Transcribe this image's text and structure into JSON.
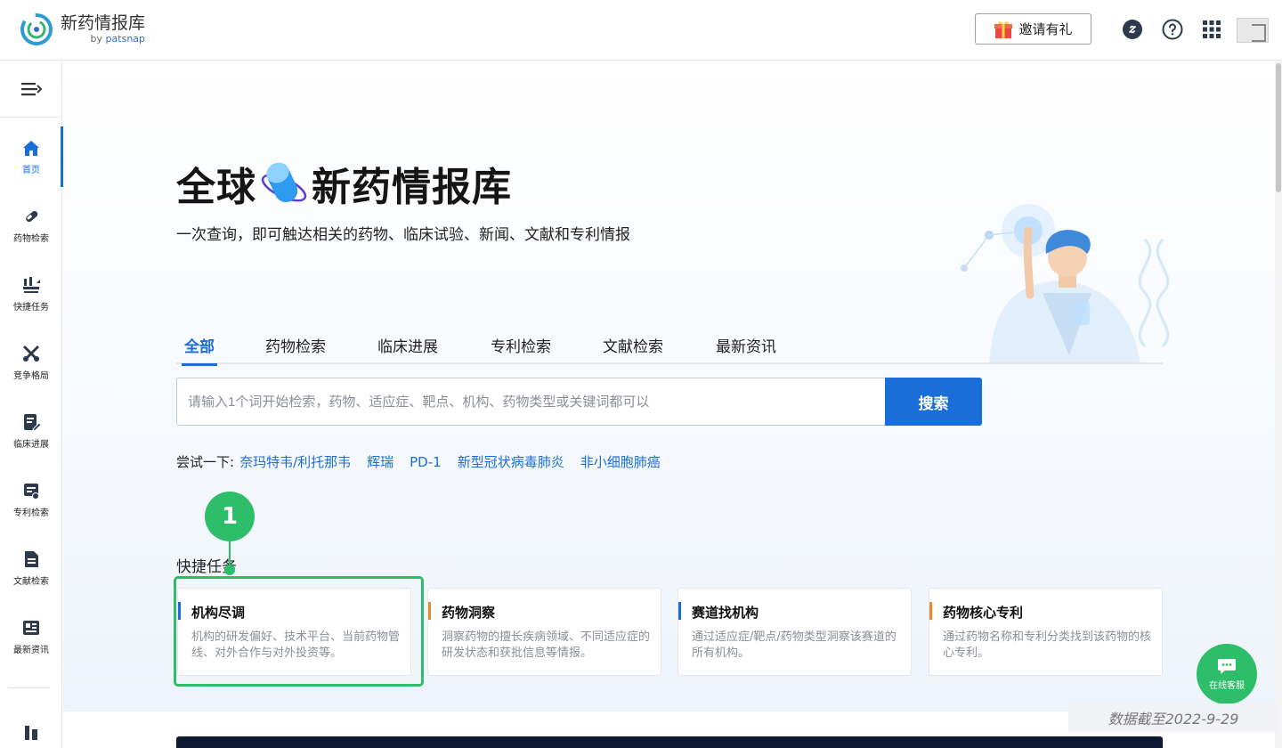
{
  "header": {
    "logo_title": "新药情报库",
    "logo_by": "by",
    "logo_brand": "patsnap",
    "invite_label": "邀请有礼"
  },
  "sidebar": {
    "items": [
      {
        "label": "首页",
        "icon": "home-icon"
      },
      {
        "label": "药物检索",
        "icon": "pill-icon"
      },
      {
        "label": "快捷任务",
        "icon": "quick-task-icon"
      },
      {
        "label": "竞争格局",
        "icon": "competition-icon"
      },
      {
        "label": "临床进展",
        "icon": "clinical-icon"
      },
      {
        "label": "专利检索",
        "icon": "patent-icon"
      },
      {
        "label": "文献检索",
        "icon": "document-icon"
      },
      {
        "label": "最新资讯",
        "icon": "news-icon"
      }
    ]
  },
  "hero": {
    "title_left": "全球",
    "title_right": "新药情报库",
    "subtitle": "一次查询，即可触达相关的药物、临床试验、新闻、文献和专利情报"
  },
  "tabs": [
    "全部",
    "药物检索",
    "临床进展",
    "专利检索",
    "文献检索",
    "最新资讯"
  ],
  "search": {
    "placeholder": "请输入1个词开始检索，药物、适应症、靶点、机构、药物类型或关键词都可以",
    "value": "",
    "button_label": "搜索"
  },
  "try": {
    "label": "尝试一下:",
    "links": [
      "奈玛特韦/利托那韦",
      "辉瑞",
      "PD-1",
      "新型冠状病毒肺炎",
      "非小细胞肺癌"
    ]
  },
  "quick_tasks": {
    "title": "快捷任务",
    "cards": [
      {
        "title": "机构尽调",
        "desc": "机构的研发偏好、技术平台、当前药物管线、对外合作与对外投资等。",
        "accent": "#1a6ed8"
      },
      {
        "title": "药物洞察",
        "desc": "洞察药物的擅长疾病领域、不同适应症的研发状态和获批信息等情报。",
        "accent": "#e8892b"
      },
      {
        "title": "赛道找机构",
        "desc": "通过适应症/靶点/药物类型洞察该赛道的所有机构。",
        "accent": "#1a6ed8"
      },
      {
        "title": "药物核心专利",
        "desc": "通过药物名称和专利分类找到该药物的核心专利。",
        "accent": "#e8892b"
      }
    ]
  },
  "annotation": {
    "marker": "1"
  },
  "chat": {
    "label": "在线客服"
  },
  "data_date": "数据截至2022-9-29",
  "colors": {
    "primary": "#1a6ed8",
    "highlight": "#2ebd68"
  }
}
